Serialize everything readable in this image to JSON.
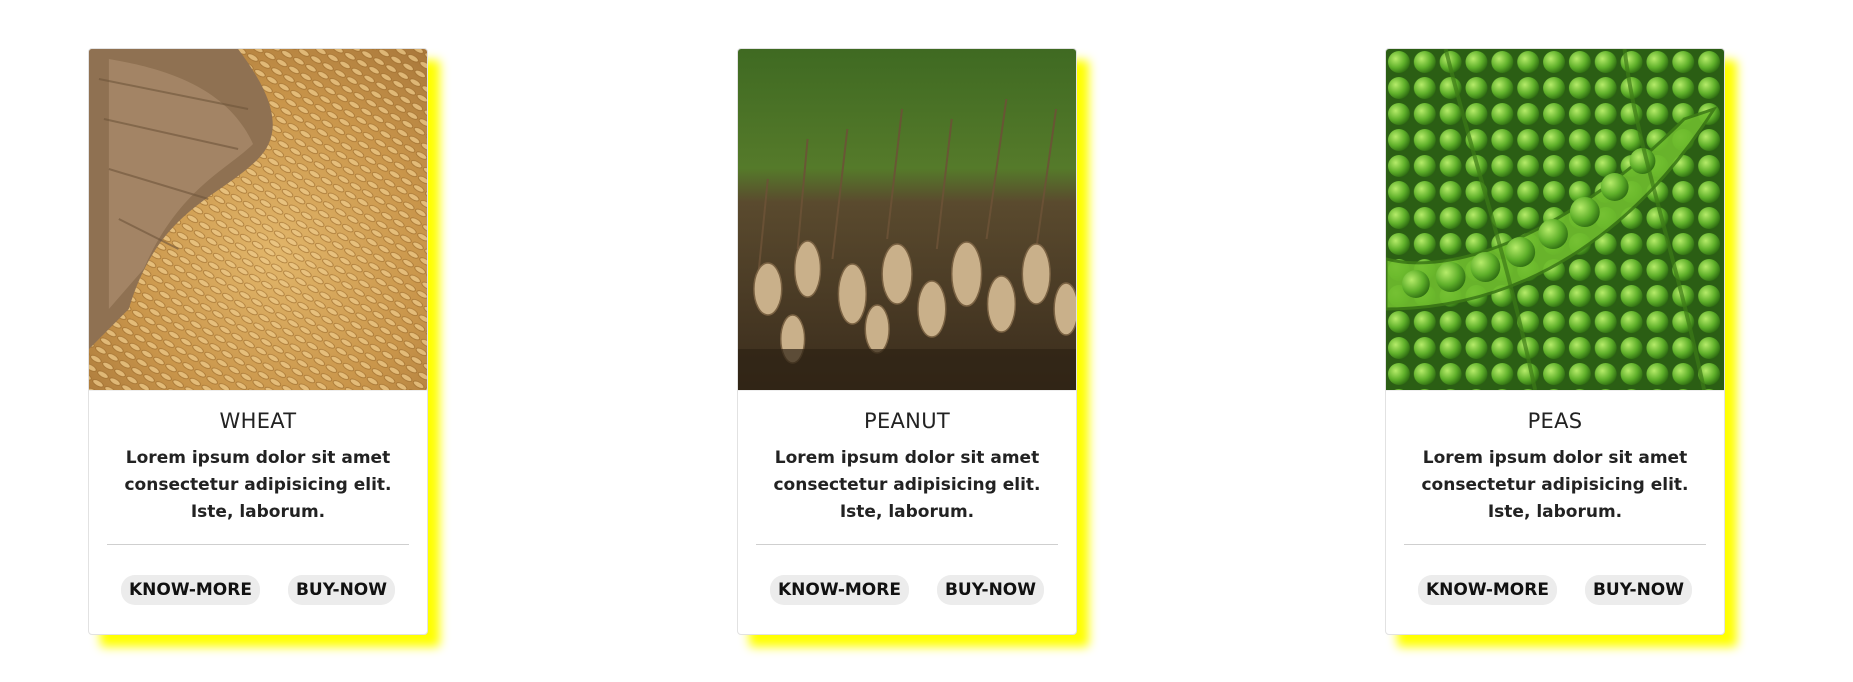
{
  "colors": {
    "shadow": "#ffff00",
    "card_border": "#e2e2e2",
    "button_bg": "#ececec"
  },
  "cards": [
    {
      "image": "wheat-grain-sack-photo",
      "title": "WHEAT",
      "text": "Lorem ipsum dolor sit amet consectetur adipisicing elit. Iste, laborum.",
      "know_more": "KNOW-MORE",
      "buy_now": "BUY-NOW"
    },
    {
      "image": "peanut-plants-photo",
      "title": "PEANUT",
      "text": "Lorem ipsum dolor sit amet consectetur adipisicing elit. Iste, laborum.",
      "know_more": "KNOW-MORE",
      "buy_now": "BUY-NOW"
    },
    {
      "image": "green-peas-pods-photo",
      "title": "PEAS",
      "text": "Lorem ipsum dolor sit amet consectetur adipisicing elit. Iste, laborum.",
      "know_more": "KNOW-MORE",
      "buy_now": "BUY-NOW"
    }
  ]
}
